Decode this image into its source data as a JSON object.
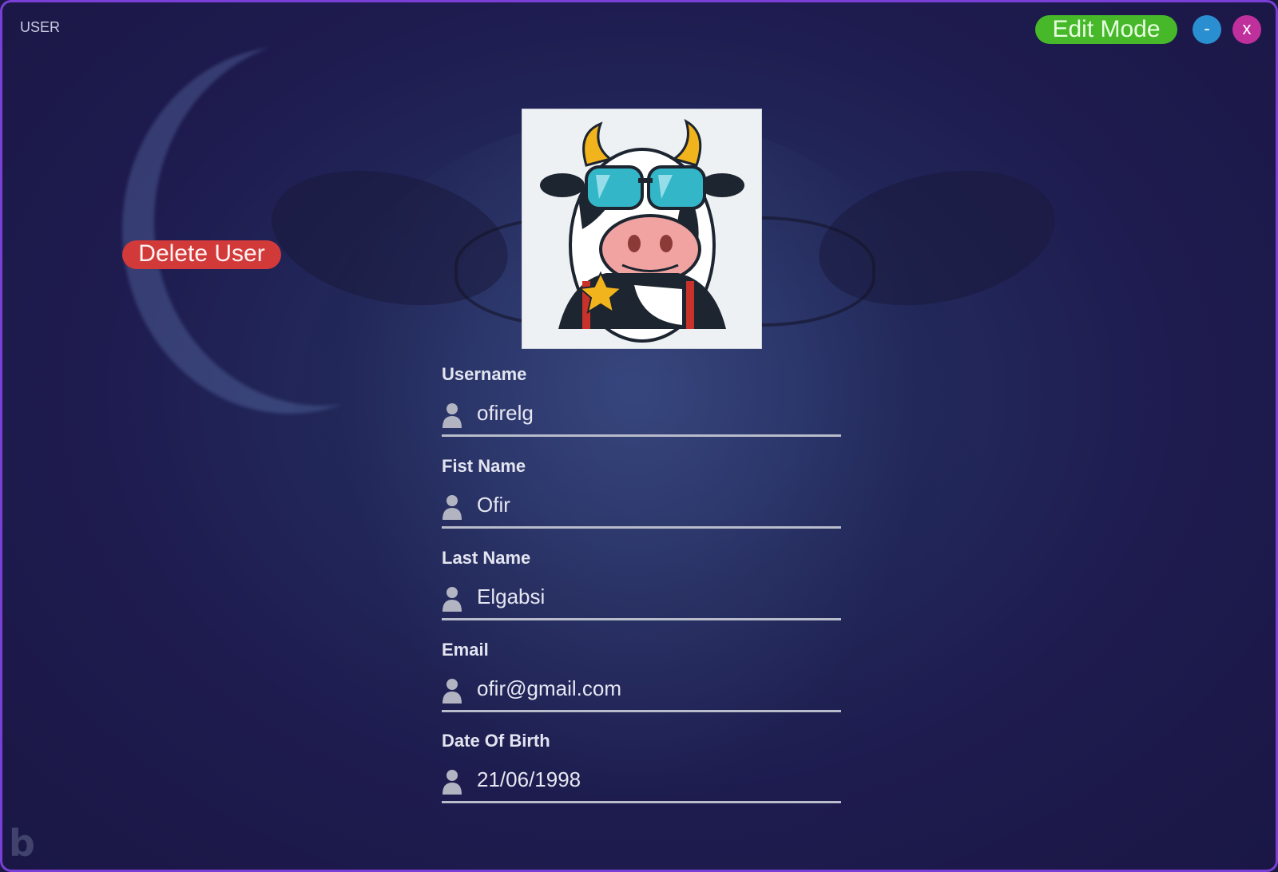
{
  "window": {
    "title": "USER"
  },
  "header": {
    "edit_mode_label": "Edit Mode",
    "minimize_label": "-",
    "close_label": "x"
  },
  "actions": {
    "delete_user_label": "Delete User"
  },
  "profile": {
    "avatar_icon": "cow-with-sunglasses-avatar"
  },
  "form": {
    "fields": [
      {
        "label": "Username",
        "value": "ofirelg",
        "icon": "person-icon"
      },
      {
        "label": "Fist Name",
        "value": "Ofir",
        "icon": "person-icon"
      },
      {
        "label": "Last Name",
        "value": "Elgabsi",
        "icon": "person-icon"
      },
      {
        "label": "Email",
        "value": "ofir@gmail.com",
        "icon": "person-icon"
      },
      {
        "label": "Date Of Birth",
        "value": "21/06/1998",
        "icon": "person-icon"
      }
    ]
  },
  "colors": {
    "edit_mode": "#46b829",
    "minimize": "#2a8fd0",
    "close": "#c0309c",
    "delete": "#d23a3a",
    "window_border": "#7a3fd6",
    "background": "#1e1b4f"
  }
}
